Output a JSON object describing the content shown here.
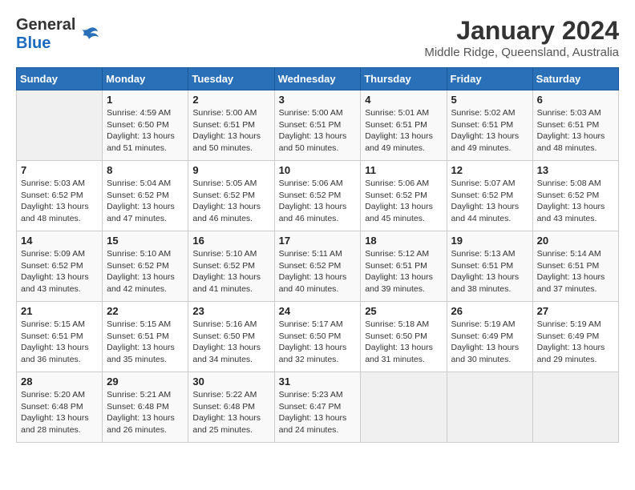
{
  "header": {
    "logo_line1": "General",
    "logo_line2": "Blue",
    "month_title": "January 2024",
    "location": "Middle Ridge, Queensland, Australia"
  },
  "days_of_week": [
    "Sunday",
    "Monday",
    "Tuesday",
    "Wednesday",
    "Thursday",
    "Friday",
    "Saturday"
  ],
  "weeks": [
    [
      {
        "day": "",
        "info": ""
      },
      {
        "day": "1",
        "info": "Sunrise: 4:59 AM\nSunset: 6:50 PM\nDaylight: 13 hours\nand 51 minutes."
      },
      {
        "day": "2",
        "info": "Sunrise: 5:00 AM\nSunset: 6:51 PM\nDaylight: 13 hours\nand 50 minutes."
      },
      {
        "day": "3",
        "info": "Sunrise: 5:00 AM\nSunset: 6:51 PM\nDaylight: 13 hours\nand 50 minutes."
      },
      {
        "day": "4",
        "info": "Sunrise: 5:01 AM\nSunset: 6:51 PM\nDaylight: 13 hours\nand 49 minutes."
      },
      {
        "day": "5",
        "info": "Sunrise: 5:02 AM\nSunset: 6:51 PM\nDaylight: 13 hours\nand 49 minutes."
      },
      {
        "day": "6",
        "info": "Sunrise: 5:03 AM\nSunset: 6:51 PM\nDaylight: 13 hours\nand 48 minutes."
      }
    ],
    [
      {
        "day": "7",
        "info": "Sunrise: 5:03 AM\nSunset: 6:52 PM\nDaylight: 13 hours\nand 48 minutes."
      },
      {
        "day": "8",
        "info": "Sunrise: 5:04 AM\nSunset: 6:52 PM\nDaylight: 13 hours\nand 47 minutes."
      },
      {
        "day": "9",
        "info": "Sunrise: 5:05 AM\nSunset: 6:52 PM\nDaylight: 13 hours\nand 46 minutes."
      },
      {
        "day": "10",
        "info": "Sunrise: 5:06 AM\nSunset: 6:52 PM\nDaylight: 13 hours\nand 46 minutes."
      },
      {
        "day": "11",
        "info": "Sunrise: 5:06 AM\nSunset: 6:52 PM\nDaylight: 13 hours\nand 45 minutes."
      },
      {
        "day": "12",
        "info": "Sunrise: 5:07 AM\nSunset: 6:52 PM\nDaylight: 13 hours\nand 44 minutes."
      },
      {
        "day": "13",
        "info": "Sunrise: 5:08 AM\nSunset: 6:52 PM\nDaylight: 13 hours\nand 43 minutes."
      }
    ],
    [
      {
        "day": "14",
        "info": "Sunrise: 5:09 AM\nSunset: 6:52 PM\nDaylight: 13 hours\nand 43 minutes."
      },
      {
        "day": "15",
        "info": "Sunrise: 5:10 AM\nSunset: 6:52 PM\nDaylight: 13 hours\nand 42 minutes."
      },
      {
        "day": "16",
        "info": "Sunrise: 5:10 AM\nSunset: 6:52 PM\nDaylight: 13 hours\nand 41 minutes."
      },
      {
        "day": "17",
        "info": "Sunrise: 5:11 AM\nSunset: 6:52 PM\nDaylight: 13 hours\nand 40 minutes."
      },
      {
        "day": "18",
        "info": "Sunrise: 5:12 AM\nSunset: 6:51 PM\nDaylight: 13 hours\nand 39 minutes."
      },
      {
        "day": "19",
        "info": "Sunrise: 5:13 AM\nSunset: 6:51 PM\nDaylight: 13 hours\nand 38 minutes."
      },
      {
        "day": "20",
        "info": "Sunrise: 5:14 AM\nSunset: 6:51 PM\nDaylight: 13 hours\nand 37 minutes."
      }
    ],
    [
      {
        "day": "21",
        "info": "Sunrise: 5:15 AM\nSunset: 6:51 PM\nDaylight: 13 hours\nand 36 minutes."
      },
      {
        "day": "22",
        "info": "Sunrise: 5:15 AM\nSunset: 6:51 PM\nDaylight: 13 hours\nand 35 minutes."
      },
      {
        "day": "23",
        "info": "Sunrise: 5:16 AM\nSunset: 6:50 PM\nDaylight: 13 hours\nand 34 minutes."
      },
      {
        "day": "24",
        "info": "Sunrise: 5:17 AM\nSunset: 6:50 PM\nDaylight: 13 hours\nand 32 minutes."
      },
      {
        "day": "25",
        "info": "Sunrise: 5:18 AM\nSunset: 6:50 PM\nDaylight: 13 hours\nand 31 minutes."
      },
      {
        "day": "26",
        "info": "Sunrise: 5:19 AM\nSunset: 6:49 PM\nDaylight: 13 hours\nand 30 minutes."
      },
      {
        "day": "27",
        "info": "Sunrise: 5:19 AM\nSunset: 6:49 PM\nDaylight: 13 hours\nand 29 minutes."
      }
    ],
    [
      {
        "day": "28",
        "info": "Sunrise: 5:20 AM\nSunset: 6:48 PM\nDaylight: 13 hours\nand 28 minutes."
      },
      {
        "day": "29",
        "info": "Sunrise: 5:21 AM\nSunset: 6:48 PM\nDaylight: 13 hours\nand 26 minutes."
      },
      {
        "day": "30",
        "info": "Sunrise: 5:22 AM\nSunset: 6:48 PM\nDaylight: 13 hours\nand 25 minutes."
      },
      {
        "day": "31",
        "info": "Sunrise: 5:23 AM\nSunset: 6:47 PM\nDaylight: 13 hours\nand 24 minutes."
      },
      {
        "day": "",
        "info": ""
      },
      {
        "day": "",
        "info": ""
      },
      {
        "day": "",
        "info": ""
      }
    ]
  ]
}
